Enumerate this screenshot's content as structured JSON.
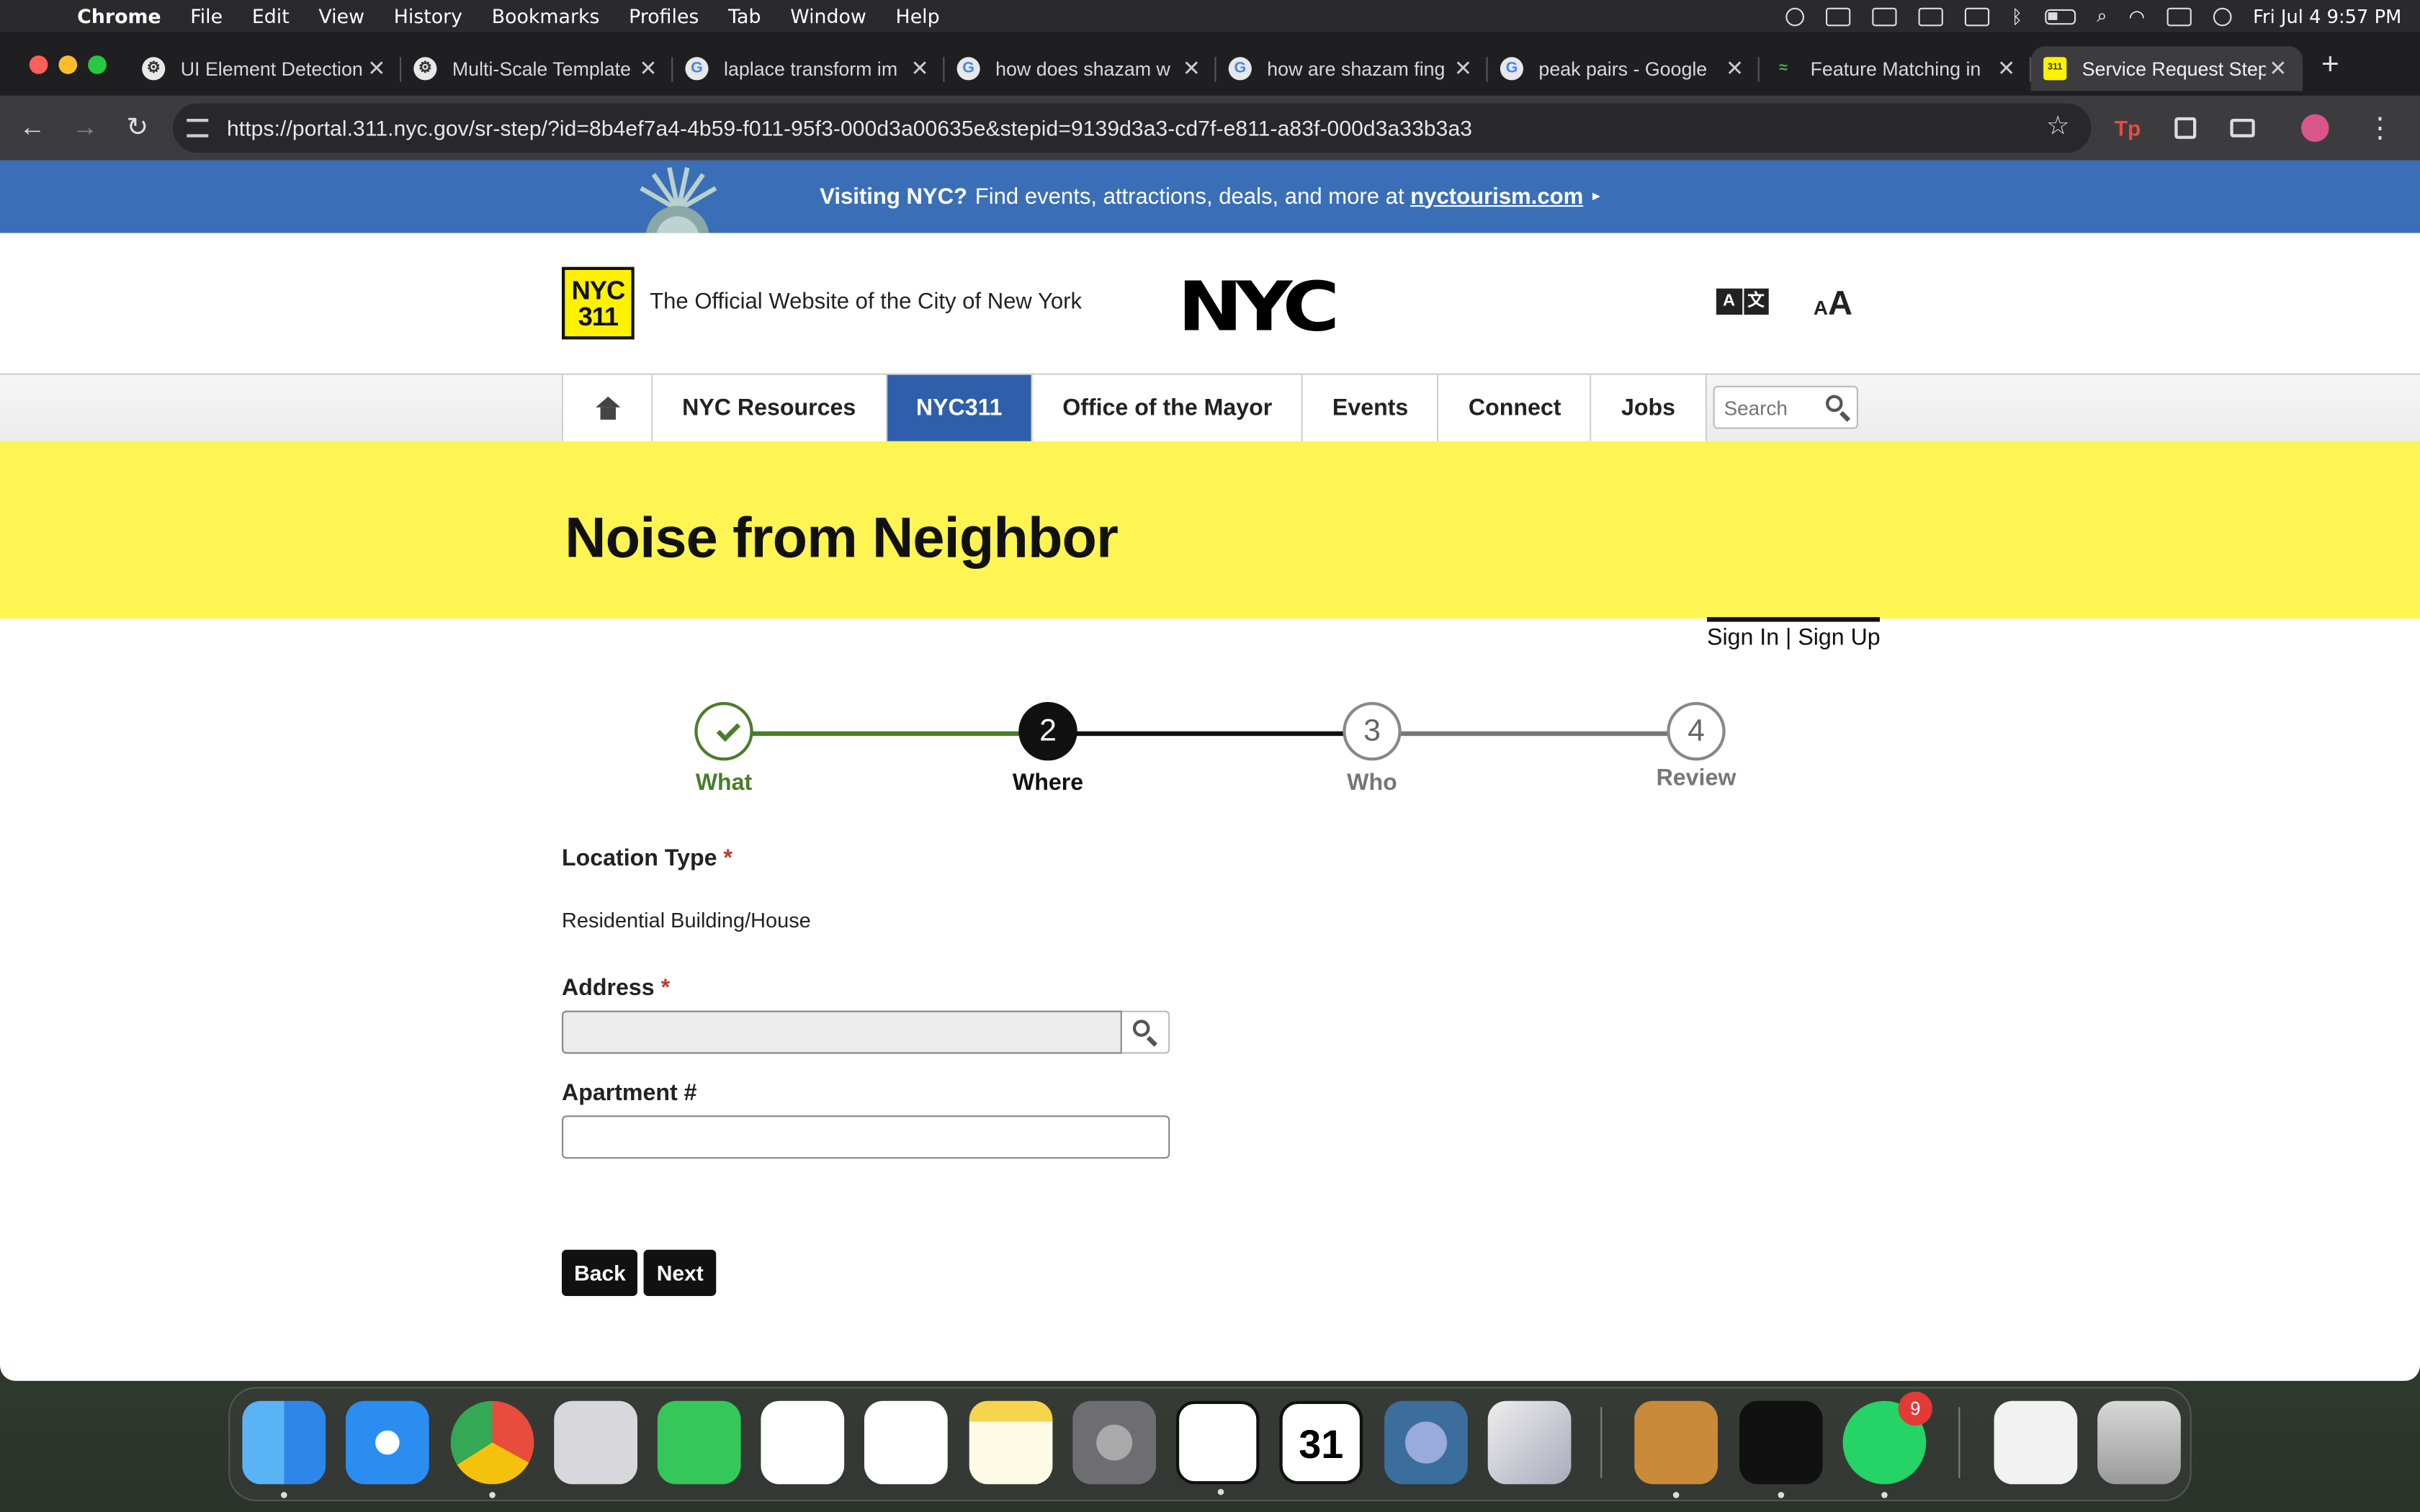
{
  "menubar": {
    "app": "Chrome",
    "items": [
      "File",
      "Edit",
      "View",
      "History",
      "Bookmarks",
      "Profiles",
      "Tab",
      "Window",
      "Help"
    ],
    "datetime": "Fri Jul 4  9:57 PM"
  },
  "tabs": [
    {
      "title": "UI Element Detection",
      "fav": "⚙"
    },
    {
      "title": "Multi-Scale Template",
      "fav": "⚙"
    },
    {
      "title": "laplace transform im",
      "fav": "G"
    },
    {
      "title": "how does shazam w",
      "fav": "G"
    },
    {
      "title": "how are shazam fing",
      "fav": "G"
    },
    {
      "title": "peak pairs - Google",
      "fav": "G"
    },
    {
      "title": "Feature Matching in",
      "fav": "≈"
    },
    {
      "title": "Service Request Step",
      "fav": "311",
      "active": true
    }
  ],
  "address": {
    "url": "https://portal.311.nyc.gov/sr-step/?id=8b4ef7a4-4b59-f011-95f3-000d3a00635e&stepid=9139d3a3-cd7f-e811-a83f-000d3a33b3a3"
  },
  "banner": {
    "bold": "Visiting NYC?",
    "text": "Find events, attractions, deals, and more at",
    "link": "nyctourism.com",
    "arrow": "▸"
  },
  "header": {
    "logo_line1": "NYC",
    "logo_line2": "311",
    "official": "The Official Website of the City of New York",
    "nyc_logo": "NYC",
    "lang_a": "A",
    "lang_b": "文",
    "text_size_small": "A",
    "text_size_big": "A"
  },
  "nav": {
    "items": [
      "NYC Resources",
      "NYC311",
      "Office of the Mayor",
      "Events",
      "Connect",
      "Jobs"
    ],
    "active": "NYC311",
    "search_placeholder": "Search"
  },
  "hero": {
    "title": "Noise from Neighbor"
  },
  "account": {
    "sign_in": "Sign In",
    "divider": "|",
    "sign_up": "Sign Up"
  },
  "steps": [
    {
      "num": "✓",
      "label": "What",
      "state": "done"
    },
    {
      "num": "2",
      "label": "Where",
      "state": "current"
    },
    {
      "num": "3",
      "label": "Who",
      "state": "todo"
    },
    {
      "num": "4",
      "label": "Review",
      "state": "todo"
    }
  ],
  "form": {
    "location_type_label": "Location Type",
    "required_mark": "*",
    "location_type_value": "Residential Building/House",
    "address_label": "Address",
    "address_value": "",
    "apartment_label": "Apartment #",
    "apartment_value": ""
  },
  "buttons": {
    "back": "Back",
    "next": "Next"
  },
  "dock": {
    "apps": [
      "Finder",
      "Safari",
      "Chrome",
      "Launchpad",
      "Messages",
      "Jira",
      "Slack",
      "Notes",
      "System Settings",
      "Notion",
      "Notion Calendar",
      "QuickTime",
      "iPhone Mirroring",
      "Bear",
      "Cursor",
      "WhatsApp",
      "Document",
      "Trash"
    ],
    "whatsapp_badge": "9",
    "calendar_day": "31"
  }
}
